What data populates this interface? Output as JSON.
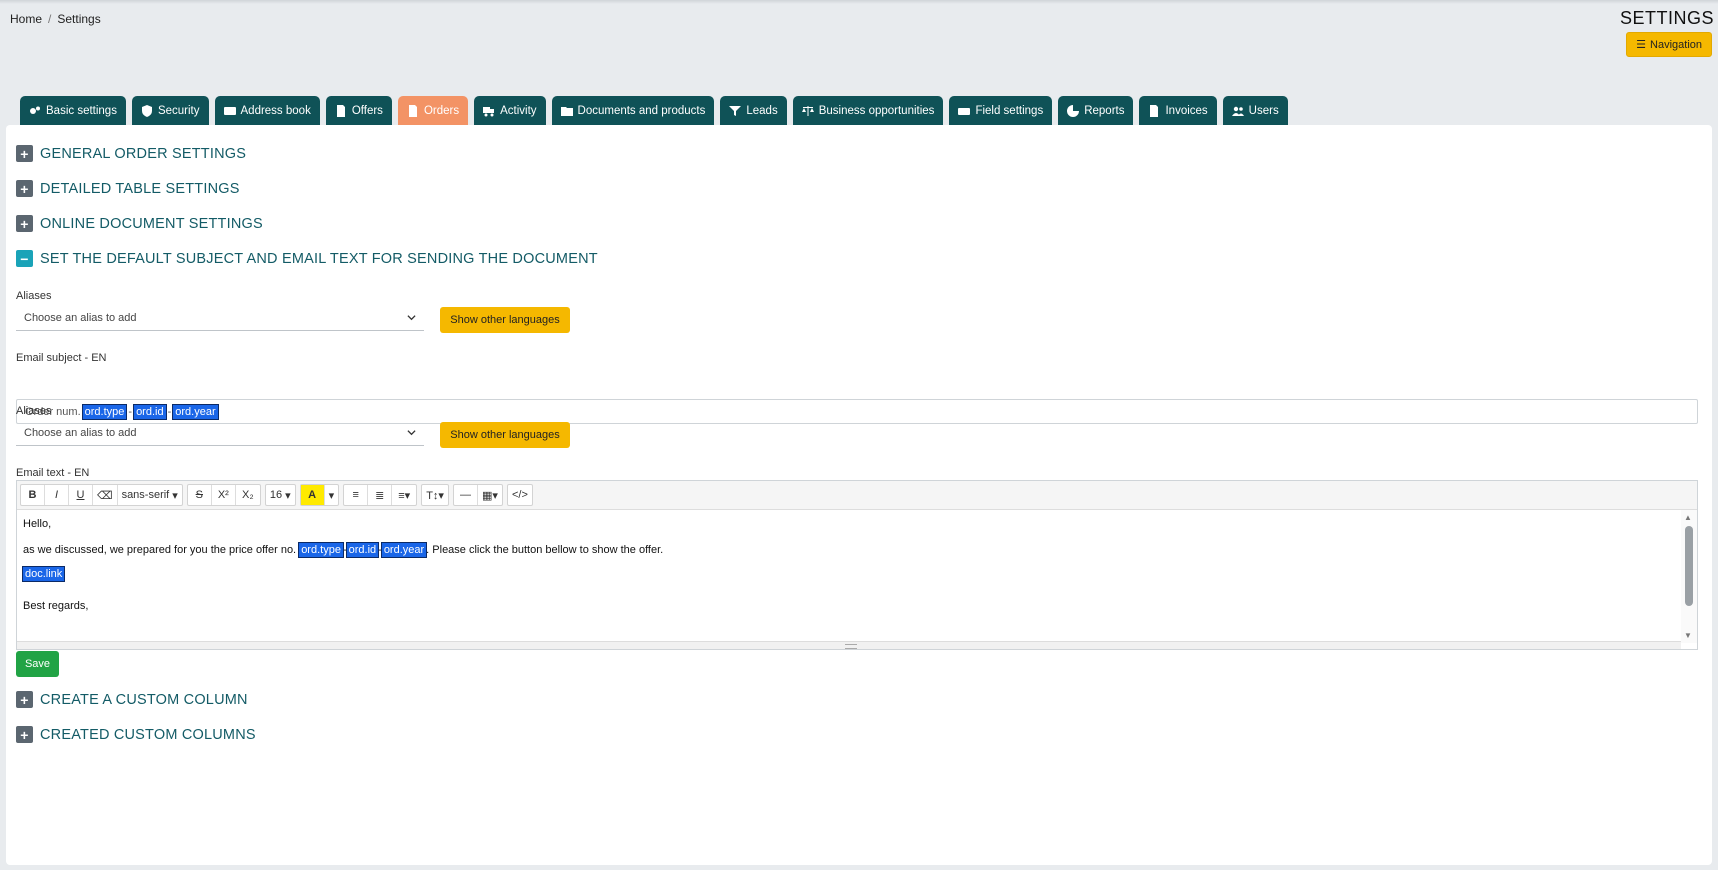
{
  "breadcrumb": {
    "home": "Home",
    "separator": "/",
    "current": "Settings"
  },
  "header": {
    "title": "SETTINGS",
    "nav_button": "Navigation"
  },
  "tabs": [
    {
      "label": "Basic settings",
      "icon": "gears-icon",
      "active": false
    },
    {
      "label": "Security",
      "icon": "shield-icon",
      "active": false
    },
    {
      "label": "Address book",
      "icon": "address-card-icon",
      "active": false
    },
    {
      "label": "Offers",
      "icon": "file-icon",
      "active": false
    },
    {
      "label": "Orders",
      "icon": "file-icon",
      "active": true
    },
    {
      "label": "Activity",
      "icon": "truck-icon",
      "active": false
    },
    {
      "label": "Documents and products",
      "icon": "folder-icon",
      "active": false
    },
    {
      "label": "Leads",
      "icon": "filter-icon",
      "active": false
    },
    {
      "label": "Business opportunities",
      "icon": "scale-icon",
      "active": false
    },
    {
      "label": "Field settings",
      "icon": "keyboard-icon",
      "active": false
    },
    {
      "label": "Reports",
      "icon": "pie-chart-icon",
      "active": false
    },
    {
      "label": "Invoices",
      "icon": "file-icon",
      "active": false
    },
    {
      "label": "Users",
      "icon": "users-icon",
      "active": false
    }
  ],
  "sections": {
    "general": "GENERAL ORDER SETTINGS",
    "detailed": "DETAILED TABLE SETTINGS",
    "online": "ONLINE DOCUMENT SETTINGS",
    "email": "SET THE DEFAULT SUBJECT AND EMAIL TEXT FOR SENDING THE DOCUMENT",
    "create_column": "CREATE A CUSTOM COLUMN",
    "created_columns": "CREATED CUSTOM COLUMNS"
  },
  "aliases1": {
    "label": "Aliases",
    "placeholder": "Choose an alias to add",
    "button": "Show other languages"
  },
  "subject": {
    "label": "Email subject - EN",
    "prefix": "Order num.",
    "tag1": "ord.type",
    "sep1": "-",
    "tag2": "ord.id",
    "sep2": "-",
    "tag3": "ord.year"
  },
  "aliases2": {
    "label": "Aliases",
    "placeholder": "Choose an alias to add",
    "button": "Show other languages"
  },
  "email_text": {
    "label": "Email text - EN",
    "toolbar": {
      "font": "sans-serif",
      "size": "16"
    },
    "line1": "Hello,",
    "line2_prefix": "as we discussed, we prepared for you the price offer no.",
    "tag1": "ord.type",
    "sep1": "-",
    "tag2": "ord.id",
    "sep2": "-",
    "tag3": "ord.year",
    "line2_suffix": ". Please click the button bellow to show the offer.",
    "link_tag": "doc.link",
    "closing": "Best regards,"
  },
  "save_label": "Save",
  "colors": {
    "tab": "#0f5257",
    "tab_active": "#f39365",
    "accent": "#f5b800",
    "save": "#21a345",
    "heading": "#135b66"
  }
}
